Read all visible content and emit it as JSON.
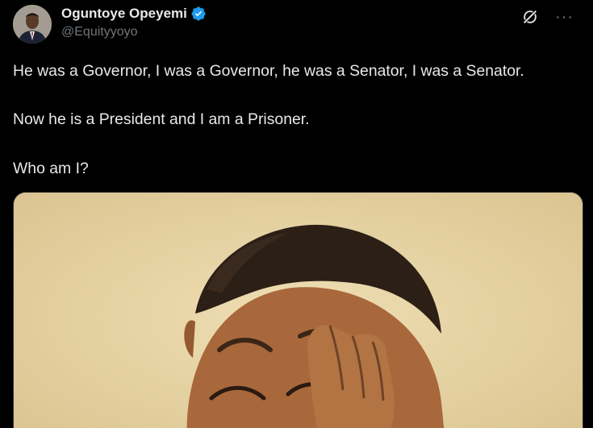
{
  "author": {
    "display_name": "Oguntoye Opeyemi",
    "handle": "@Equityyoyo",
    "verified": true,
    "avatar_icon": "profile-photo"
  },
  "actions": {
    "grok_icon": "grok-icon",
    "more_icon": "more-options-icon",
    "more_label": "···"
  },
  "tweet": {
    "paragraphs": [
      "He was a Governor, I was a Governor, he was a Senator, I was a Senator.",
      "Now he is a President and I am a Prisoner.",
      "Who am I?"
    ]
  },
  "media": {
    "type": "image",
    "description_icon": "cartoon-boy-laughing-covering-eyes"
  },
  "colors": {
    "background": "#000000",
    "text": "#e7e9ea",
    "secondary_text": "#71767b",
    "verified_badge": "#1d9bf0"
  }
}
